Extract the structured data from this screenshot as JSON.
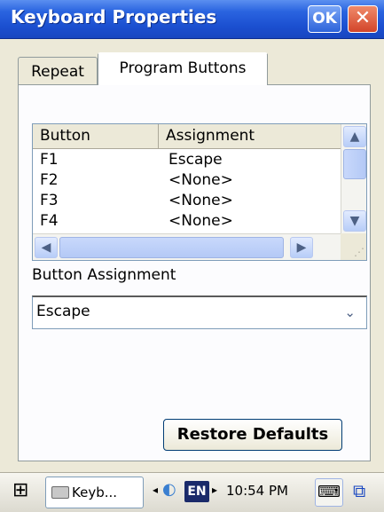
{
  "window": {
    "title": "Keyboard Properties",
    "ok_label": "OK",
    "close_label": "✕"
  },
  "tabs": [
    {
      "label": "Repeat"
    },
    {
      "label": "Program Buttons",
      "active": true
    }
  ],
  "list": {
    "columns": [
      "Button",
      "Assignment"
    ],
    "rows": [
      {
        "button": "F1",
        "assignment": "Escape"
      },
      {
        "button": "F2",
        "assignment": "<None>"
      },
      {
        "button": "F3",
        "assignment": "<None>"
      },
      {
        "button": "F4",
        "assignment": "<None>"
      }
    ]
  },
  "assignment": {
    "label": "Button Assignment",
    "value": "Escape"
  },
  "restore_label": "Restore Defaults",
  "taskbar": {
    "task_label": "Keyb...",
    "lang": "EN",
    "time": "10:54 PM"
  },
  "icons": {
    "up": "▲",
    "down": "▼",
    "left": "◀",
    "right": "▶",
    "combo_arrow": "⌄",
    "grip": "⋰",
    "start": "⊞",
    "net": "◐",
    "kbd": "⌨",
    "switch": "⧉",
    "tray_left": "◂",
    "tray_right": "▸"
  },
  "colors": {
    "titlebar": "#2a64e0",
    "close": "#d2452a",
    "selection": "#fcfcfe"
  }
}
